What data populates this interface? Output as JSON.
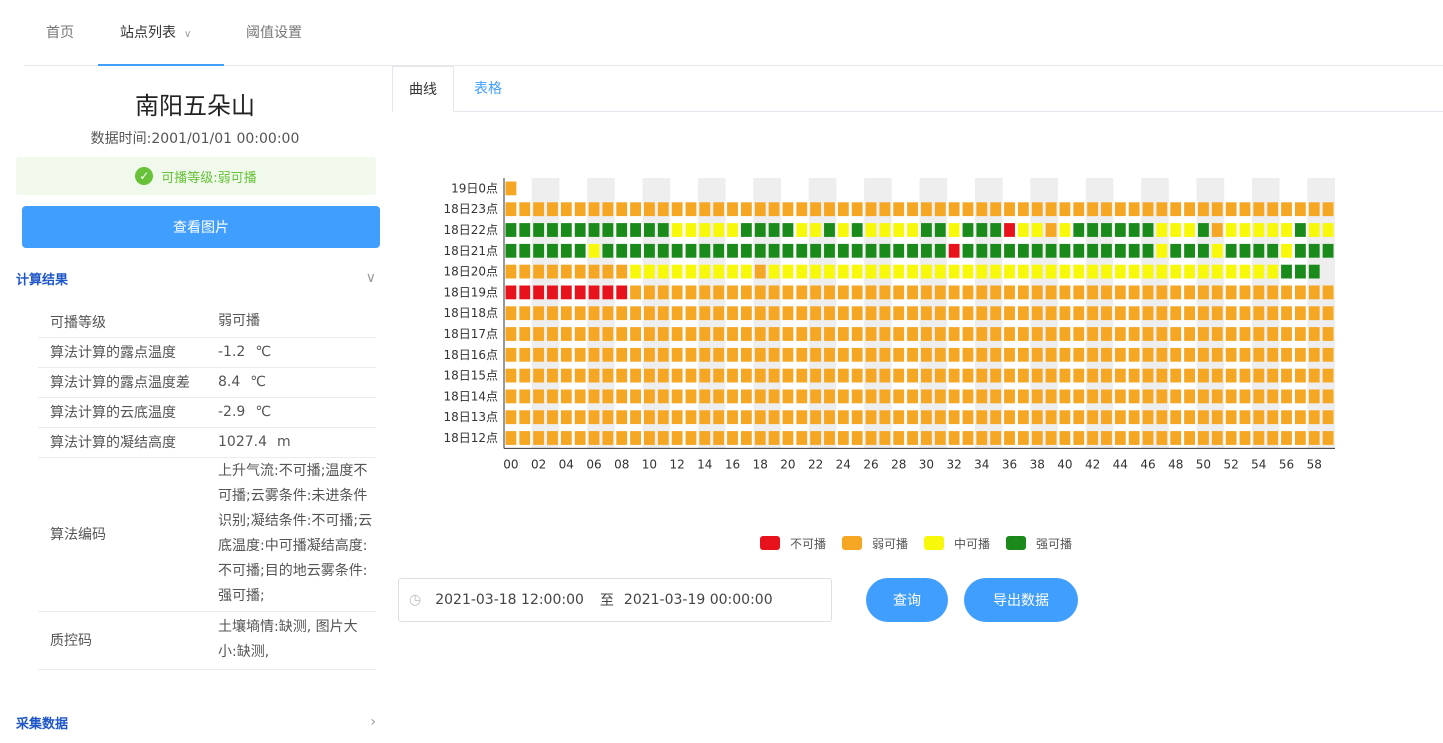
{
  "nav": {
    "home": "首页",
    "stations": "站点列表",
    "thresholds": "阈值设置"
  },
  "station": {
    "name": "南阳五朵山",
    "data_time": "数据时间:2001/01/01 00:00:00",
    "level_alert": "可播等级:弱可播",
    "view_image": "查看图片"
  },
  "calc": {
    "title": "计算结果",
    "rows": [
      {
        "key": "可播等级",
        "value": "弱可播",
        "unit": ""
      },
      {
        "key": "算法计算的露点温度",
        "value": "-1.2",
        "unit": "℃"
      },
      {
        "key": "算法计算的露点温度差",
        "value": "8.4",
        "unit": "℃"
      },
      {
        "key": "算法计算的云底温度",
        "value": "-2.9",
        "unit": "℃"
      },
      {
        "key": "算法计算的凝结高度",
        "value": "1027.4",
        "unit": "m"
      },
      {
        "key": "算法编码",
        "value": "上升气流:不可播;温度不可播;云雾条件:未进条件识别;凝结条件:不可播;云底温度:中可播凝结高度:不可播;目的地云雾条件:强可播;",
        "unit": ""
      },
      {
        "key": "质控码",
        "value": "土壤墒情:缺测, 图片大小:缺测,",
        "unit": ""
      }
    ]
  },
  "collect": {
    "title": "采集数据"
  },
  "tabs": {
    "curve": "曲线",
    "table": "表格"
  },
  "query": {
    "start": "2021-03-18 12:00:00",
    "to": "至",
    "end": "2021-03-19 00:00:00",
    "query_btn": "查询",
    "export_btn": "导出数据"
  },
  "chart_data": {
    "type": "heatmap",
    "title": "",
    "xlabel": "",
    "ylabel": "",
    "y": [
      "19日0点",
      "18日23点",
      "18日22点",
      "18日21点",
      "18日20点",
      "18日19点",
      "18日18点",
      "18日17点",
      "18日16点",
      "18日15点",
      "18日14点",
      "18日13点",
      "18日12点"
    ],
    "x_count": 60,
    "x_tick_labels": [
      "00",
      "02",
      "04",
      "06",
      "08",
      "10",
      "12",
      "14",
      "16",
      "18",
      "20",
      "22",
      "24",
      "26",
      "28",
      "30",
      "32",
      "34",
      "36",
      "38",
      "40",
      "42",
      "44",
      "46",
      "48",
      "50",
      "52",
      "54",
      "56",
      "58"
    ],
    "levels": [
      "不可播",
      "弱可播",
      "中可播",
      "强可播"
    ],
    "colors": [
      "#e8121c",
      "#f5a623",
      "#f8f80a",
      "#1a8a1a"
    ],
    "grid_band_color": "#eeeeee",
    "rows": [
      "1",
      "111111111111111111111111111111111111111111111111111111111111",
      "333333333333222223333223232222332333022123333332223122222322",
      "3333332333333333333333333333333303333333333333323332333323332",
      "11111111122222222212222222222222222222222222222222222222333",
      "000000000111111111111111111111111111111111111111111111111111",
      "111111111111111111111111111111111111111111111111111111111111",
      "111111111111111111111111111111111111111111111111111111111111",
      "111111111111111111111111111111111111111111111111111111111111",
      "111111111111111111111111111111111111111111111111111111111111",
      "111111111111111111111111111111111111111111111111111111111111",
      "111111111111111111111111111111111111111111111111111111111111",
      "111111111111111111111111111111111111111111111111111111111111"
    ]
  }
}
